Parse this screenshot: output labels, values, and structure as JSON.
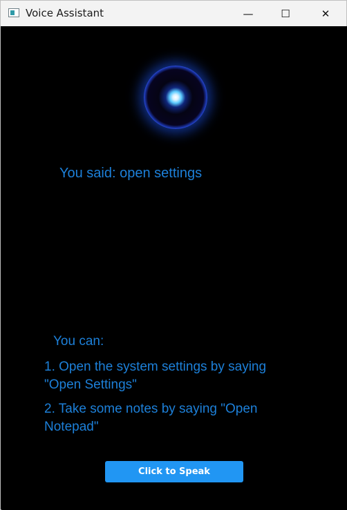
{
  "window": {
    "title": "Voice Assistant",
    "controls": {
      "minimize": "—",
      "maximize": "☐",
      "close": "✕"
    }
  },
  "assistant": {
    "heard_text": "You said: open settings",
    "options_heading": "You can:",
    "options": [
      "1. Open the system settings by saying \"Open Settings\"",
      "2. Take some notes by saying \"Open Notepad\""
    ],
    "speak_button_label": "Click to Speak"
  },
  "colors": {
    "background": "#000000",
    "text_accent": "#1d80d9",
    "button": "#2196f3"
  },
  "icons": [
    "app-window-icon",
    "voice-orb-icon",
    "minimize-icon",
    "maximize-icon",
    "close-icon"
  ]
}
